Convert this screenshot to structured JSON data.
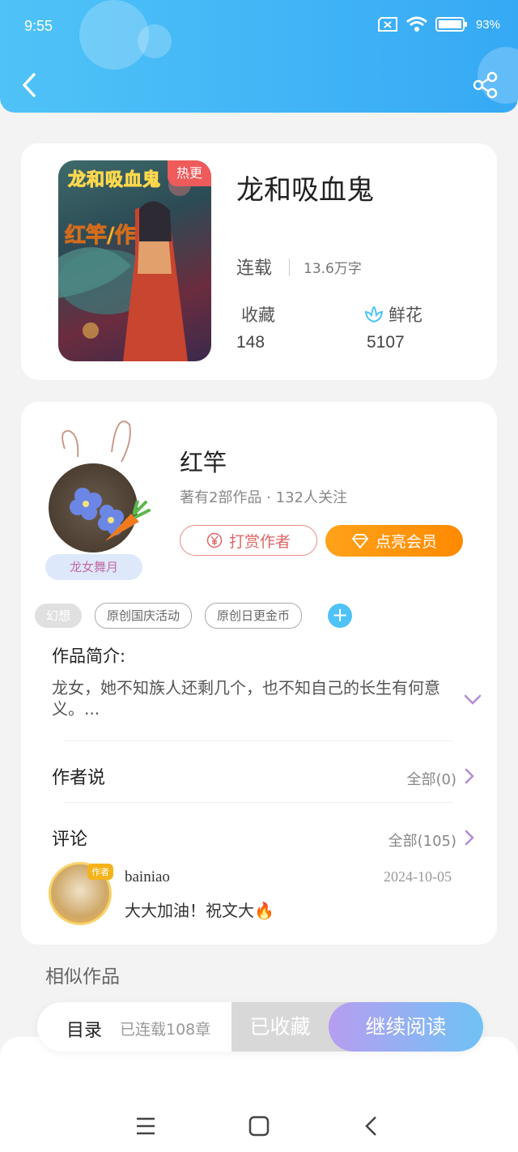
{
  "status_bar": {
    "time": "9:55",
    "battery": "93%"
  },
  "header": {
    "back_icon": "chevron-left-icon",
    "share_icon": "share-icon"
  },
  "book": {
    "cover_badge": "热更",
    "cover_title": "龙和吸血鬼",
    "cover_author": "红竿/作",
    "title": "龙和吸血鬼",
    "status": "连载",
    "word_count": "13.6万字",
    "favorites_label": "收藏",
    "favorites_value": "148",
    "flowers_label": "鲜花",
    "flowers_value": "5107"
  },
  "author": {
    "name": "红竿",
    "meta": "著有2部作品 · 132人关注",
    "badge": "龙女舞月",
    "reward_label": "打赏作者",
    "vip_label": "点亮会员"
  },
  "tags": {
    "genre": "幻想",
    "items": [
      "原创国庆活动",
      "原创日更金币"
    ]
  },
  "intro": {
    "title": "作品简介:",
    "text": "龙女，她不知族人还剩几个，也不知自己的长生有何意义。..."
  },
  "author_says": {
    "title": "作者说",
    "link": "全部(0)"
  },
  "comments": {
    "title": "评论",
    "link": "全部(105)",
    "items": [
      {
        "user": "bainiao",
        "badge": "作者",
        "date": "2024-10-05",
        "text": "大大加油！祝文大🔥"
      }
    ]
  },
  "similar": {
    "title": "相似作品"
  },
  "bottom_bar": {
    "toc_label": "目录",
    "toc_count": "已连载108章",
    "favorited_label": "已收藏",
    "continue_label": "继续阅读"
  },
  "colors": {
    "header": "#36a9f5",
    "vip": "#ff8a00",
    "reward": "#e06666",
    "accent": "#4fc3f7"
  }
}
